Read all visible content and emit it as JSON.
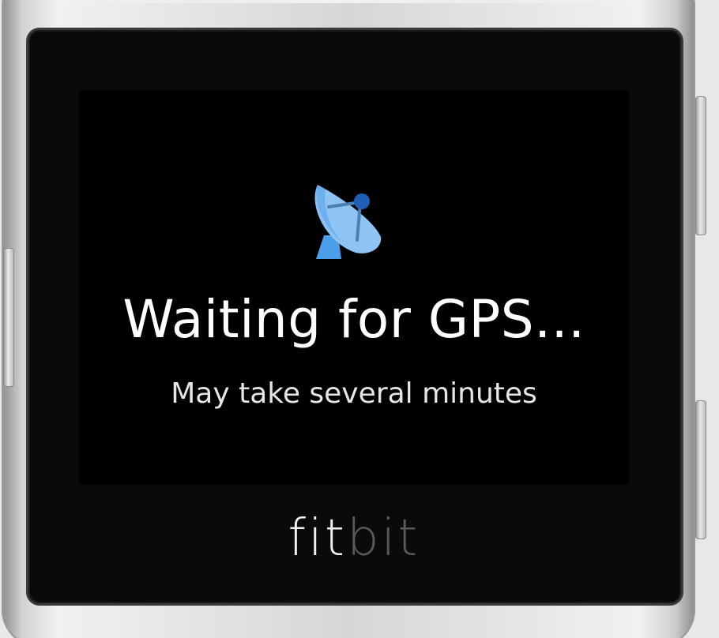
{
  "screen": {
    "title": "Waiting for GPS...",
    "subtitle": "May take several minutes",
    "icon": "satellite-dish-icon"
  },
  "device": {
    "brand_part1": "fit",
    "brand_part2": "bit"
  },
  "colors": {
    "screen_background": "#000000",
    "title_text": "#ffffff",
    "icon_blue": "#4a9fe8",
    "icon_dark_blue": "#1f5fb8"
  }
}
